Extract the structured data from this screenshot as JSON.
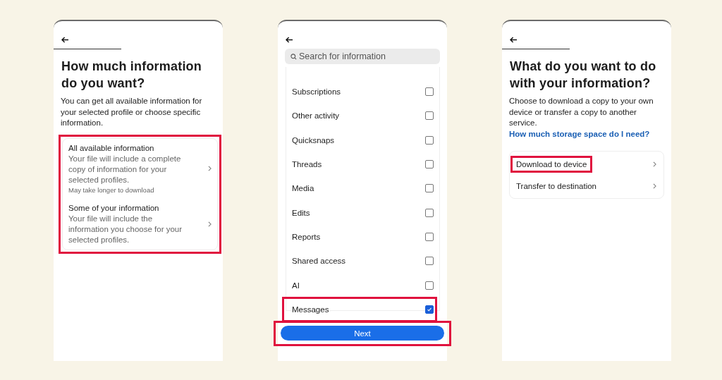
{
  "screens": [
    {
      "kind": "amount",
      "title": "How much information do you want?",
      "description": "You can get all available information for your selected profile or choose specific information.",
      "options_highlighted": true,
      "options": [
        {
          "title": "All available information",
          "detail": "Your file will include a complete copy of information for your selected profiles.",
          "note": "May take longer to download"
        },
        {
          "title": "Some of your information",
          "detail": "Your file will include the information you choose for your selected profiles."
        }
      ]
    },
    {
      "kind": "select",
      "search": {
        "placeholder": "Search for information"
      },
      "items": [
        {
          "label": "Subscriptions",
          "checked": false,
          "highlighted": false
        },
        {
          "label": "Other activity",
          "checked": false,
          "highlighted": false
        },
        {
          "label": "Quicksnaps",
          "checked": false,
          "highlighted": false
        },
        {
          "label": "Threads",
          "checked": false,
          "highlighted": false
        },
        {
          "label": "Media",
          "checked": false,
          "highlighted": false
        },
        {
          "label": "Edits",
          "checked": false,
          "highlighted": false
        },
        {
          "label": "Reports",
          "checked": false,
          "highlighted": false
        },
        {
          "label": "Shared access",
          "checked": false,
          "highlighted": false
        },
        {
          "label": "AI",
          "checked": false,
          "highlighted": false
        },
        {
          "label": "Messages",
          "checked": true,
          "highlighted": true
        }
      ],
      "button": {
        "label": "Next",
        "highlighted": true
      }
    },
    {
      "kind": "destination",
      "title": "What do you want to do with your information?",
      "description": "Choose to download a copy to your own device or transfer a copy to another service.",
      "link": "How much storage space do I need?",
      "options": [
        {
          "title": "Download to device",
          "highlighted": true
        },
        {
          "title": "Transfer to destination",
          "highlighted": false
        }
      ]
    }
  ]
}
